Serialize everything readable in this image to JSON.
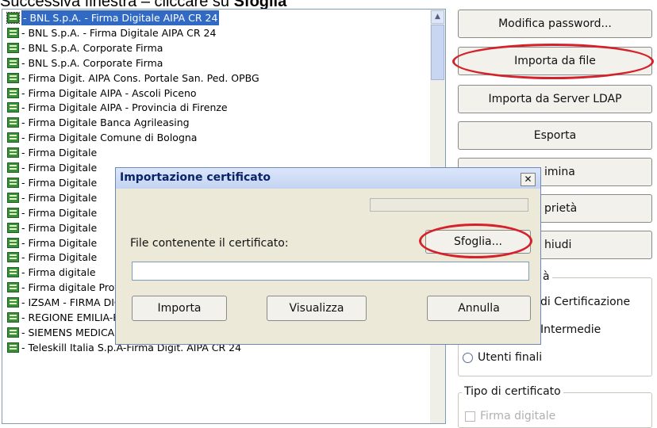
{
  "caption": {
    "prefix": "Successiva finestra – cliccare su ",
    "bold": "Sfoglia"
  },
  "list": {
    "items": [
      {
        "label": "- BNL S.p.A. - Firma Digitale AIPA CR 24",
        "selected": true
      },
      {
        "label": "- BNL S.p.A. - Firma Digitale AIPA CR 24"
      },
      {
        "label": "- BNL S.p.A. Corporate Firma"
      },
      {
        "label": "- BNL S.p.A. Corporate Firma"
      },
      {
        "label": "- Firma Digit. AIPA Cons. Portale San. Ped. OPBG"
      },
      {
        "label": "- Firma Digitale AIPA - Ascoli Piceno"
      },
      {
        "label": "- Firma Digitale AIPA - Provincia di Firenze"
      },
      {
        "label": "- Firma Digitale Banca Agrileasing"
      },
      {
        "label": "- Firma Digitale Comune di Bologna"
      },
      {
        "label": "- Firma Digitale"
      },
      {
        "label": "- Firma Digitale"
      },
      {
        "label": "- Firma Digitale"
      },
      {
        "label": "- Firma Digitale"
      },
      {
        "label": "- Firma Digitale"
      },
      {
        "label": "- Firma Digitale"
      },
      {
        "label": "- Firma Digitale"
      },
      {
        "label": "- Firma Digitale"
      },
      {
        "label": "- Firma digitale"
      },
      {
        "label": "- Firma digitale Provincia di Varese"
      },
      {
        "label": "- IZSAM - FIRMA DIGITALE"
      },
      {
        "label": "- REGIONE EMILIA-ROMAGNA FORMAZIONE FIRMA DIGIT."
      },
      {
        "label": "- SIEMENS MEDICAL SOLUTIONS"
      },
      {
        "label": "- Teleskill Italia S.p.A-Firma Digit. AIPA CR 24"
      }
    ],
    "scroll_up_icon": "▲"
  },
  "buttons": {
    "modifica_password": "Modifica password...",
    "importa_da_file": "Importa da file",
    "importa_ldap": "Importa da Server LDAP",
    "esporta": "Esporta",
    "elimina_partial": "imina",
    "proprieta_partial": "prietà",
    "chiudi_partial": "hiudi"
  },
  "groups": {
    "tipologia": {
      "title_partial": "à",
      "options": [
        "di Certificazione",
        "Intermedie",
        "Utenti finali"
      ]
    },
    "tipo_certificato": {
      "title": "Tipo di certificato",
      "option_partial": "Firma digitale"
    }
  },
  "dialog": {
    "title": "Importazione certificato",
    "close_icon": "✕",
    "label": "File contenente il certificato:",
    "input_value": "",
    "browse_button": "Sfoglia...",
    "import_button": "Importa",
    "view_button": "Visualizza",
    "cancel_button": "Annulla"
  },
  "colors": {
    "highlight_ring": "#d4212a",
    "selection": "#316ac5"
  }
}
